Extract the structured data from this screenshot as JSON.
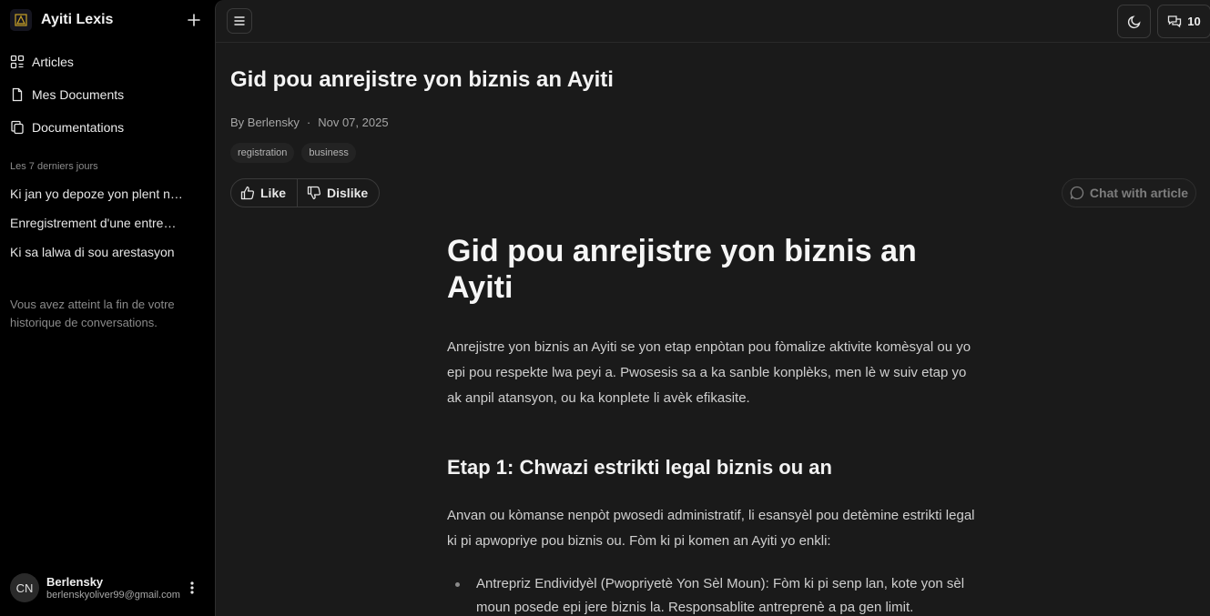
{
  "sidebar": {
    "brand": "Ayiti Lexis",
    "nav": [
      {
        "label": "Articles",
        "icon": "grid-icon"
      },
      {
        "label": "Mes Documents",
        "icon": "file-icon"
      },
      {
        "label": "Documentations",
        "icon": "copy-icon"
      }
    ],
    "section_label": "Les 7 derniers jours",
    "conversations": [
      "Ki jan yo depoze yon plent nan...",
      "Enregistrement d'une entreprise...",
      "Ki sa lalwa di sou arestasyon"
    ],
    "end_note": "Vous avez atteint la fin de votre historique de conversations.",
    "user": {
      "initials": "CN",
      "name": "Berlensky",
      "email": "berlenskyoliver99@gmail.com"
    }
  },
  "topbar": {
    "chat_count": "10"
  },
  "article": {
    "title": "Gid pou anrejistre yon biznis an Ayiti",
    "author": "By Berlensky",
    "date": "Nov 07, 2025",
    "tags": [
      "registration",
      "business"
    ],
    "like_label": "Like",
    "dislike_label": "Dislike",
    "chat_label": "Chat with article",
    "body": {
      "heading": "Gid pou anrejistre yon biznis an Ayiti",
      "intro": "Anrejistre yon biznis an Ayiti se yon etap enpòtan pou fòmalize aktivite komèsyal ou yo epi pou respekte lwa peyi a. Pwosesis sa a ka sanble konplèks, men lè w suiv etap yo ak anpil atansyon, ou ka konplete li avèk efikasite.",
      "step1_heading": "Etap 1: Chwazi estrikti legal biznis ou an",
      "step1_text": "Anvan ou kòmanse nenpòt pwosedi administratif, li esansyèl pou detèmine estrikti legal ki pi apwopriye pou biznis ou. Fòm ki pi komen an Ayiti yo enkli:",
      "list": [
        "Antrepriz Endividyèl (Pwopriyetè Yon Sèl Moun): Fòm ki pi senp lan, kote yon sèl moun posede epi jere biznis la. Responsablite antreprenè a pa gen limit."
      ]
    }
  },
  "colors": {
    "sidebar_bg": "#000000",
    "main_bg": "#1a1a1a",
    "brand_logo_accent": "#c9a227"
  }
}
